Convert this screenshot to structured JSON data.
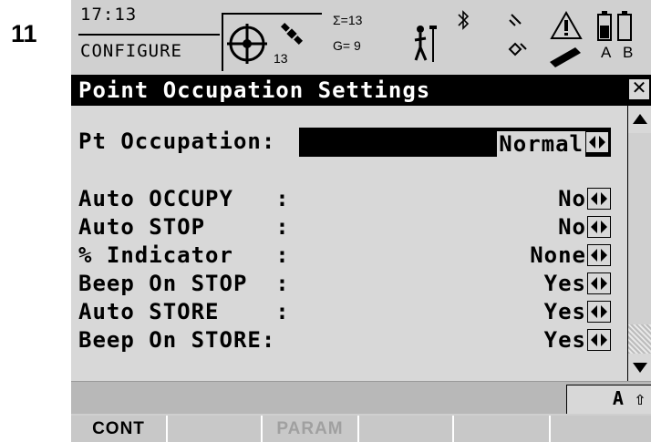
{
  "step_number": "11",
  "status": {
    "time": "17:13",
    "mode": "CONFIGURE",
    "satellites_tracked": "13",
    "sum_sat": "Σ=13",
    "gps_sat": "G= 9",
    "battery_labels": [
      "A",
      "B"
    ]
  },
  "title": "Point Occupation Settings",
  "fields": [
    {
      "label": "Pt Occupation:",
      "value": "Normal"
    },
    {
      "label": "Auto OCCUPY   :",
      "value": "No"
    },
    {
      "label": "Auto STOP     :",
      "value": "No"
    },
    {
      "label": "% Indicator   :",
      "value": "None"
    },
    {
      "label": "Beep On STOP  :",
      "value": "Yes"
    },
    {
      "label": "Auto STORE    :",
      "value": "Yes"
    },
    {
      "label": "Beep On STORE:",
      "value": "Yes"
    }
  ],
  "input_mode": "A ⇧",
  "softkeys": [
    "CONT",
    "",
    "PARAM",
    "",
    "",
    ""
  ],
  "colors": {
    "screen_bg": "#d8d8d8",
    "title_bg": "#000000",
    "title_fg": "#ffffff"
  }
}
